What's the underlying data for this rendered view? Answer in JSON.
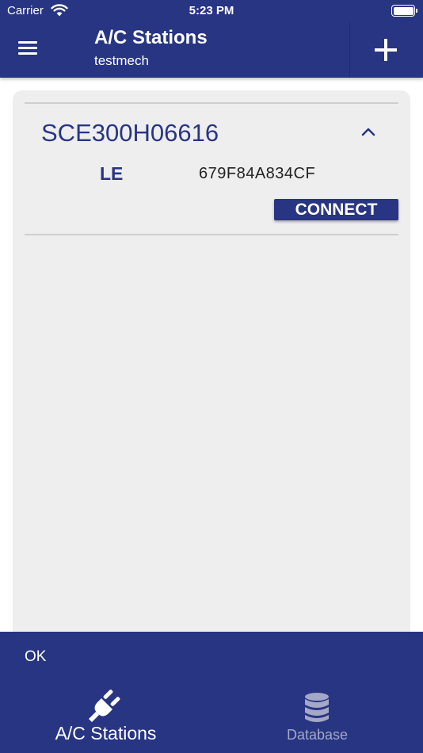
{
  "status_bar": {
    "carrier": "Carrier",
    "time": "5:23 PM",
    "wifi_icon": "wifi-icon",
    "battery_icon": "battery-icon"
  },
  "header": {
    "menu_icon": "hamburger-menu-icon",
    "title": "A/C Stations",
    "subtitle": "testmech",
    "add_icon": "plus-icon",
    "background": "#283583"
  },
  "station": {
    "name": "SCE300H06616",
    "protocol": "LE",
    "address": "679F84A834CF",
    "connect_label": "CONNECT",
    "expanded": true,
    "toggle_icon": "chevron-up-icon"
  },
  "bottom_bar": {
    "ok_label": "OK",
    "tabs": [
      {
        "label": "A/C Stations",
        "icon": "plug-icon",
        "active": true
      },
      {
        "label": "Database",
        "icon": "database-icon",
        "active": false
      }
    ]
  },
  "colors": {
    "brand": "#283583",
    "card_background": "#eeeeee",
    "inactive_tab": "#a4a8c6"
  }
}
